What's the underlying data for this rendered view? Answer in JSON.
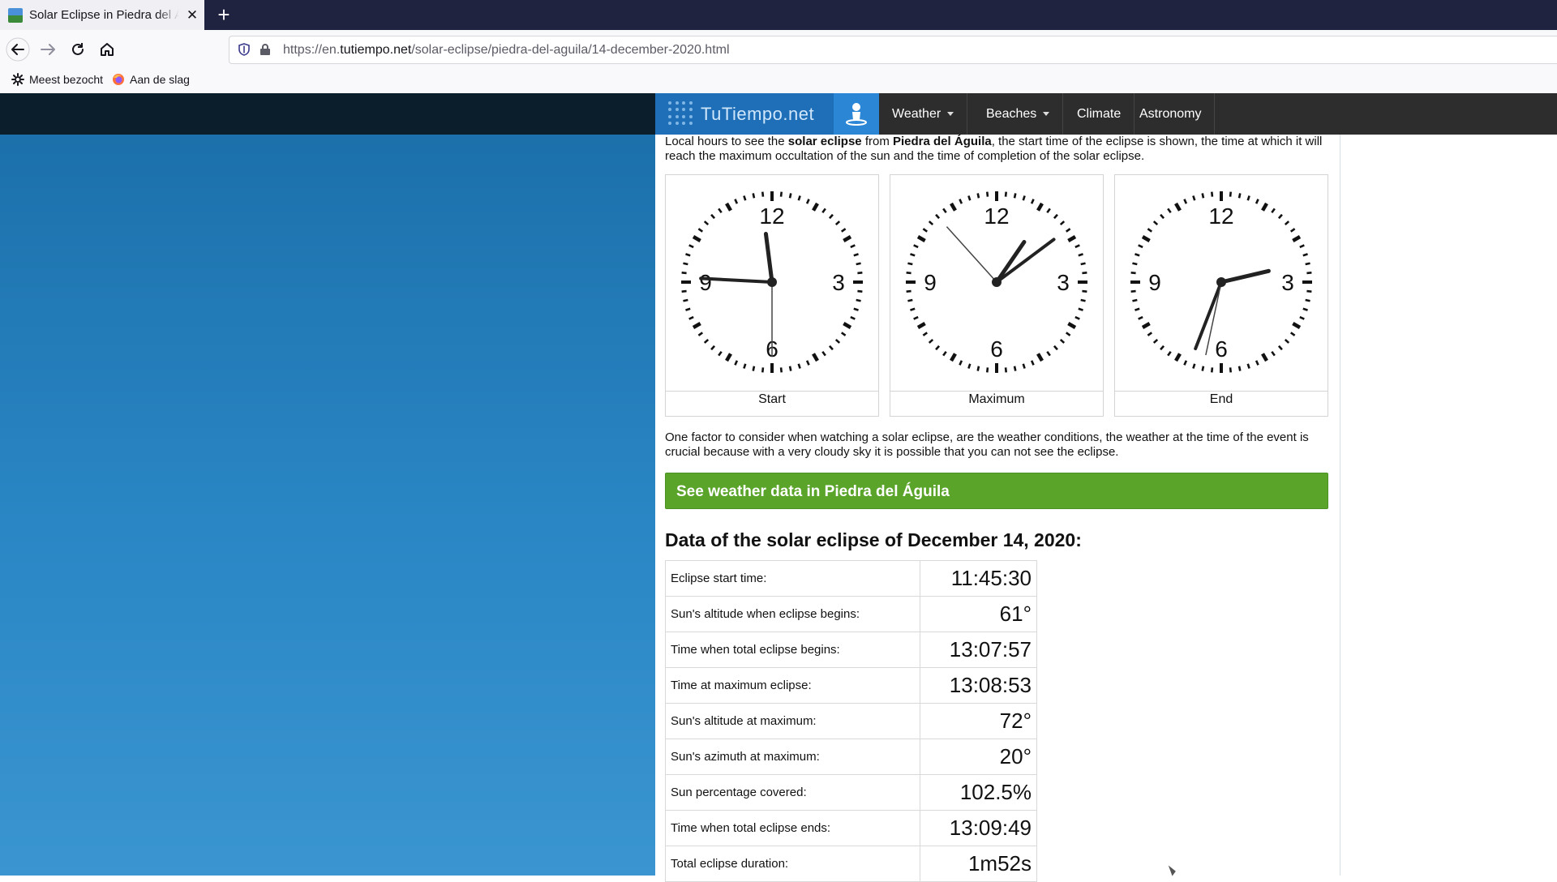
{
  "browser": {
    "tab_title": "Solar Eclipse in Piedra del Águila",
    "tab_close": "✕",
    "new_tab": "+",
    "url_prefix": "https://en.",
    "url_domain": "tutiempo.net",
    "url_path": "/solar-eclipse/piedra-del-aguila/14-december-2020.html",
    "bookmarks": [
      {
        "label": "Meest bezocht",
        "icon": "gear-icon"
      },
      {
        "label": "Aan de slag",
        "icon": "firefox-icon"
      }
    ]
  },
  "site": {
    "logo": "TuTiempo.net",
    "menu": {
      "weather": "Weather",
      "beaches": "Beaches",
      "climate": "Climate",
      "astronomy": "Astronomy"
    }
  },
  "intro": {
    "part1": "Local hours to see the ",
    "bold1": "solar eclipse",
    "part2": " from ",
    "bold2": "Piedra del Águila",
    "part3": ", the start time of the eclipse is shown, the time at which it will reach the maximum occultation of the sun and the time of completion of the solar eclipse."
  },
  "clocks": [
    {
      "label": "Start",
      "time": "11:45:30"
    },
    {
      "label": "Maximum",
      "time": "13:08:53"
    },
    {
      "label": "End",
      "time": "14:33:32"
    }
  ],
  "clock_numerals": {
    "n12": "12",
    "n3": "3",
    "n6": "6",
    "n9": "9"
  },
  "factor_text": "One factor to consider when watching a solar eclipse, are the weather conditions, the weather at the time of the event is crucial because with a very cloudy sky it is possible that you can not see the eclipse.",
  "weather_button": "See weather data in Piedra del Águila",
  "data_title": "Data of the solar eclipse of December 14, 2020:",
  "eclipse_data": [
    {
      "key": "Eclipse start time:",
      "value": "11:45:30"
    },
    {
      "key": "Sun's altitude when eclipse begins:",
      "value": "61°"
    },
    {
      "key": "Time when total eclipse begins:",
      "value": "13:07:57"
    },
    {
      "key": "Time at maximum eclipse:",
      "value": "13:08:53"
    },
    {
      "key": "Sun's altitude at maximum:",
      "value": "72°"
    },
    {
      "key": "Sun's azimuth at maximum:",
      "value": "20°"
    },
    {
      "key": "Sun percentage covered:",
      "value": "102.5%"
    },
    {
      "key": "Time when total eclipse ends:",
      "value": "13:09:49"
    },
    {
      "key": "Total eclipse duration:",
      "value": "1m52s"
    }
  ],
  "colors": {
    "tabbar": "#202340",
    "site_nav": "#2d2d2d",
    "logo_bg": "#1e6fb8",
    "weather_button": "#5aa42a"
  }
}
